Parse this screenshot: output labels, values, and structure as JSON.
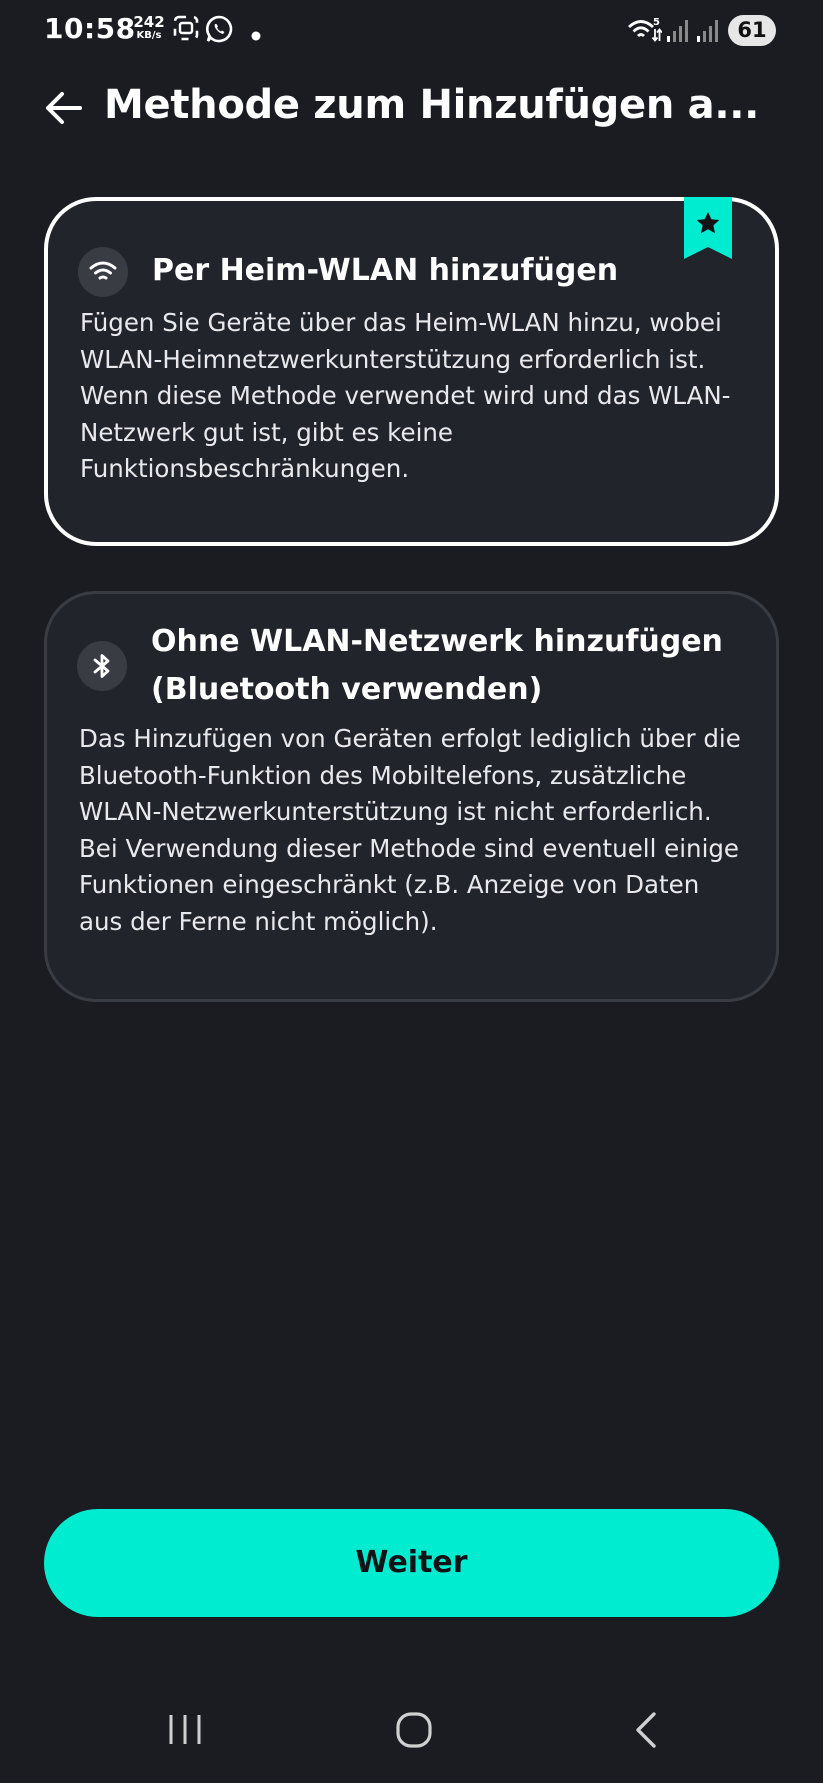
{
  "status_bar": {
    "time": "10:58",
    "net_speed_value": "242",
    "net_speed_unit": "KB/s",
    "battery": "61",
    "icons": [
      "screenshot-icon",
      "whatsapp-icon",
      "notification-dot-icon",
      "wifi-icon",
      "signal-icon",
      "signal-icon"
    ]
  },
  "header": {
    "title": "Methode zum Hinzufügen a...",
    "back_icon": "arrow-left-icon"
  },
  "options": [
    {
      "icon": "wifi-icon",
      "title": "Per Heim-WLAN hinzufügen",
      "description": "Fügen Sie Geräte über das Heim-WLAN hinzu, wobei WLAN-Heimnetzwerkunterstützung erforderlich ist. Wenn diese Methode verwendet wird und das WLAN-Netzwerk gut ist, gibt es keine Funktionsbeschränkungen.",
      "selected": true,
      "badge_icon": "star-icon"
    },
    {
      "icon": "bluetooth-icon",
      "title": "Ohne WLAN-Netzwerk hinzufügen (Bluetooth verwenden)",
      "description": "Das Hinzufügen von Geräten erfolgt lediglich über die Bluetooth-Funktion des Mobiltelefons, zusätzliche WLAN-Netzwerkunterstützung ist nicht erforderlich. Bei Verwendung dieser Methode sind eventuell einige Funktionen eingeschränkt (z.B. Anzeige von Daten aus der Ferne nicht möglich).",
      "selected": false
    }
  ],
  "continue_button": {
    "label": "Weiter"
  },
  "nav_bar": {
    "icons": [
      "recent-apps-icon",
      "home-icon",
      "back-icon"
    ]
  },
  "colors": {
    "background": "#1b1c21",
    "card": "#22242b",
    "accent": "#00ecd0",
    "selected_border": "#ffffff"
  }
}
